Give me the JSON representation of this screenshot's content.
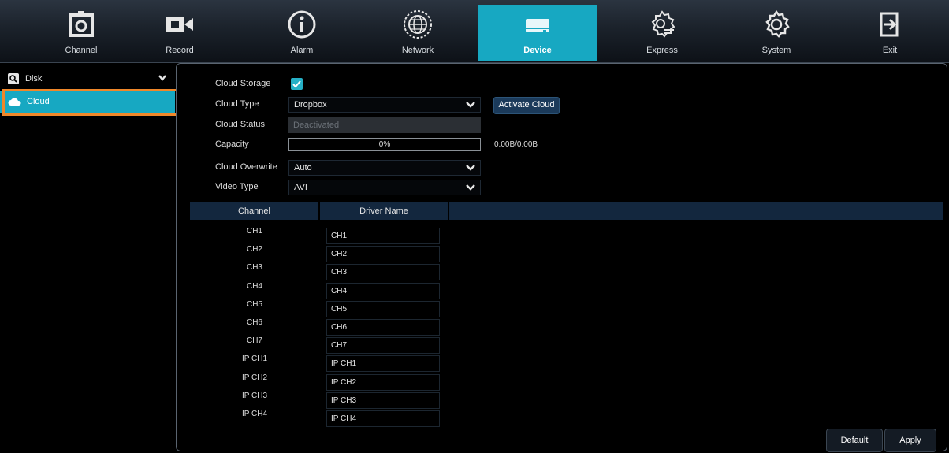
{
  "nav": {
    "items": [
      {
        "label": "Channel",
        "icon": "camera-icon"
      },
      {
        "label": "Record",
        "icon": "video-camera-icon"
      },
      {
        "label": "Alarm",
        "icon": "info-icon"
      },
      {
        "label": "Network",
        "icon": "globe-icon"
      },
      {
        "label": "Device",
        "icon": "hard-drive-icon"
      },
      {
        "label": "Express",
        "icon": "gear-hand-icon"
      },
      {
        "label": "System",
        "icon": "gear-icon"
      },
      {
        "label": "Exit",
        "icon": "exit-icon"
      }
    ],
    "active": "Device",
    "accent_color": "#17a8c2"
  },
  "sidebar": {
    "disk_label": "Disk",
    "cloud_label": "Cloud",
    "highlight_color": "#f0872a"
  },
  "form": {
    "cloud_storage_label": "Cloud Storage",
    "cloud_storage_checked": true,
    "cloud_type_label": "Cloud Type",
    "cloud_type_value": "Dropbox",
    "activate_label": "Activate Cloud",
    "cloud_status_label": "Cloud Status",
    "cloud_status_value": "Deactivated",
    "capacity_label": "Capacity",
    "capacity_percent_text": "0%",
    "capacity_fraction": 0,
    "capacity_size": "0.00B/0.00B",
    "overwrite_label": "Cloud Overwrite",
    "overwrite_value": "Auto",
    "video_type_label": "Video Type",
    "video_type_value": "AVI"
  },
  "table": {
    "headers": [
      "Channel",
      "Driver Name"
    ],
    "rows": [
      {
        "channel": "CH1",
        "driver": "CH1"
      },
      {
        "channel": "CH2",
        "driver": "CH2"
      },
      {
        "channel": "CH3",
        "driver": "CH3"
      },
      {
        "channel": "CH4",
        "driver": "CH4"
      },
      {
        "channel": "CH5",
        "driver": "CH5"
      },
      {
        "channel": "CH6",
        "driver": "CH6"
      },
      {
        "channel": "CH7",
        "driver": "CH7"
      },
      {
        "channel": "IP CH1",
        "driver": "IP CH1"
      },
      {
        "channel": "IP CH2",
        "driver": "IP CH2"
      },
      {
        "channel": "IP CH3",
        "driver": "IP CH3"
      },
      {
        "channel": "IP CH4",
        "driver": "IP CH4"
      }
    ]
  },
  "buttons": {
    "default_label": "Default",
    "apply_label": "Apply"
  }
}
